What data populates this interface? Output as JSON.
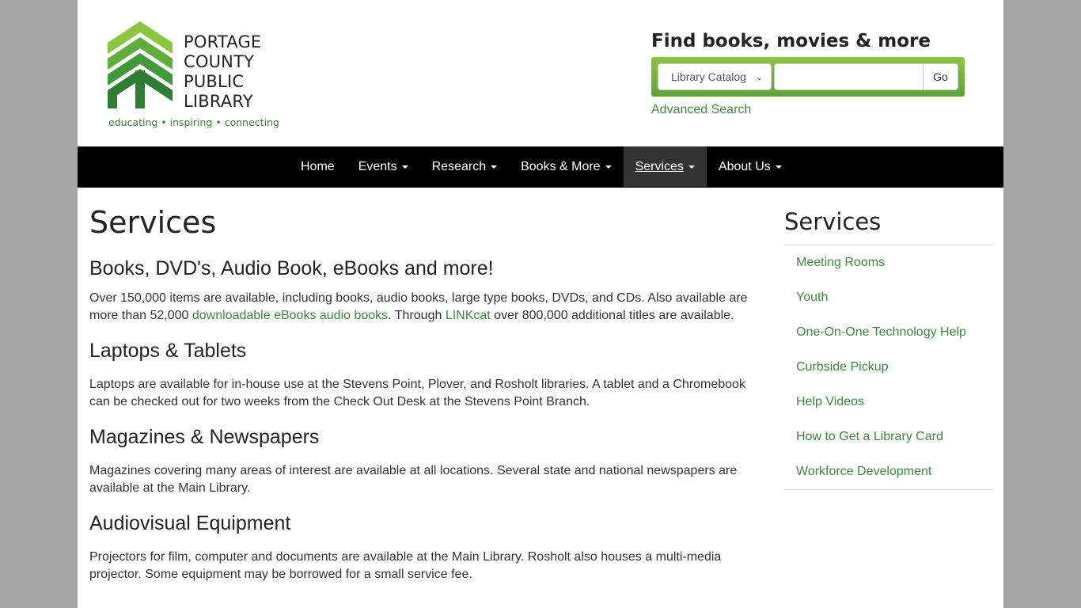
{
  "logo": {
    "name_lines": [
      "PORTAGE",
      "COUNTY",
      "PUBLIC",
      "LIBRARY"
    ],
    "tagline": "educating • inspiring • connecting",
    "icon": "tree-chevron-logo",
    "colors": {
      "light_green": "#8cc63f",
      "dark_green": "#2e7d32"
    }
  },
  "search": {
    "title": "Find books, movies & more",
    "select_value": "Library Catalog",
    "input_value": "",
    "go_label": "Go",
    "advanced_label": "Advanced Search"
  },
  "nav": {
    "items": [
      {
        "label": "Home",
        "dropdown": false,
        "active": false
      },
      {
        "label": "Events",
        "dropdown": true,
        "active": false
      },
      {
        "label": "Research",
        "dropdown": true,
        "active": false
      },
      {
        "label": "Books & More",
        "dropdown": true,
        "active": false
      },
      {
        "label": "Services",
        "dropdown": true,
        "active": true
      },
      {
        "label": "About Us",
        "dropdown": true,
        "active": false
      }
    ]
  },
  "main": {
    "title": "Services",
    "sections": [
      {
        "heading": "Books, DVD's, Audio Book, eBooks and more!",
        "text_before": "Over 150,000 items are available, including books, audio books, large type books, DVDs, and CDs. Also available are more than 52,000 ",
        "link1": "downloadable eBooks audio books",
        "text_middle": ". Through ",
        "link2": "LINKcat",
        "text_after": " over 800,000 additional titles are available."
      },
      {
        "heading": "Laptops & Tablets",
        "text": "Laptops are available for in-house use at the Stevens Point, Plover, and Rosholt libraries. A tablet and a Chromebook can be checked out for two weeks from the Check Out Desk at the Stevens Point Branch."
      },
      {
        "heading": "Magazines & Newspapers",
        "text": "Magazines covering many areas of interest are available at all locations. Several state and national newspapers are available at the Main Library."
      },
      {
        "heading": "Audiovisual Equipment",
        "text": "Projectors for film, computer and documents are available at the Main Library. Rosholt also houses a multi-media projector. Some equipment may be borrowed for a small service fee."
      }
    ]
  },
  "sidebar": {
    "title": "Services",
    "items": [
      "Meeting Rooms",
      "Youth",
      "One-On-One Technology Help",
      "Curbside Pickup",
      "Help Videos",
      "How to Get a Library Card",
      "Workforce Development"
    ]
  },
  "colors": {
    "link_green": "#3a8a3e",
    "nav_bg": "#000000",
    "nav_active_bg": "#333333",
    "outer_bg": "#a6a6a6"
  }
}
